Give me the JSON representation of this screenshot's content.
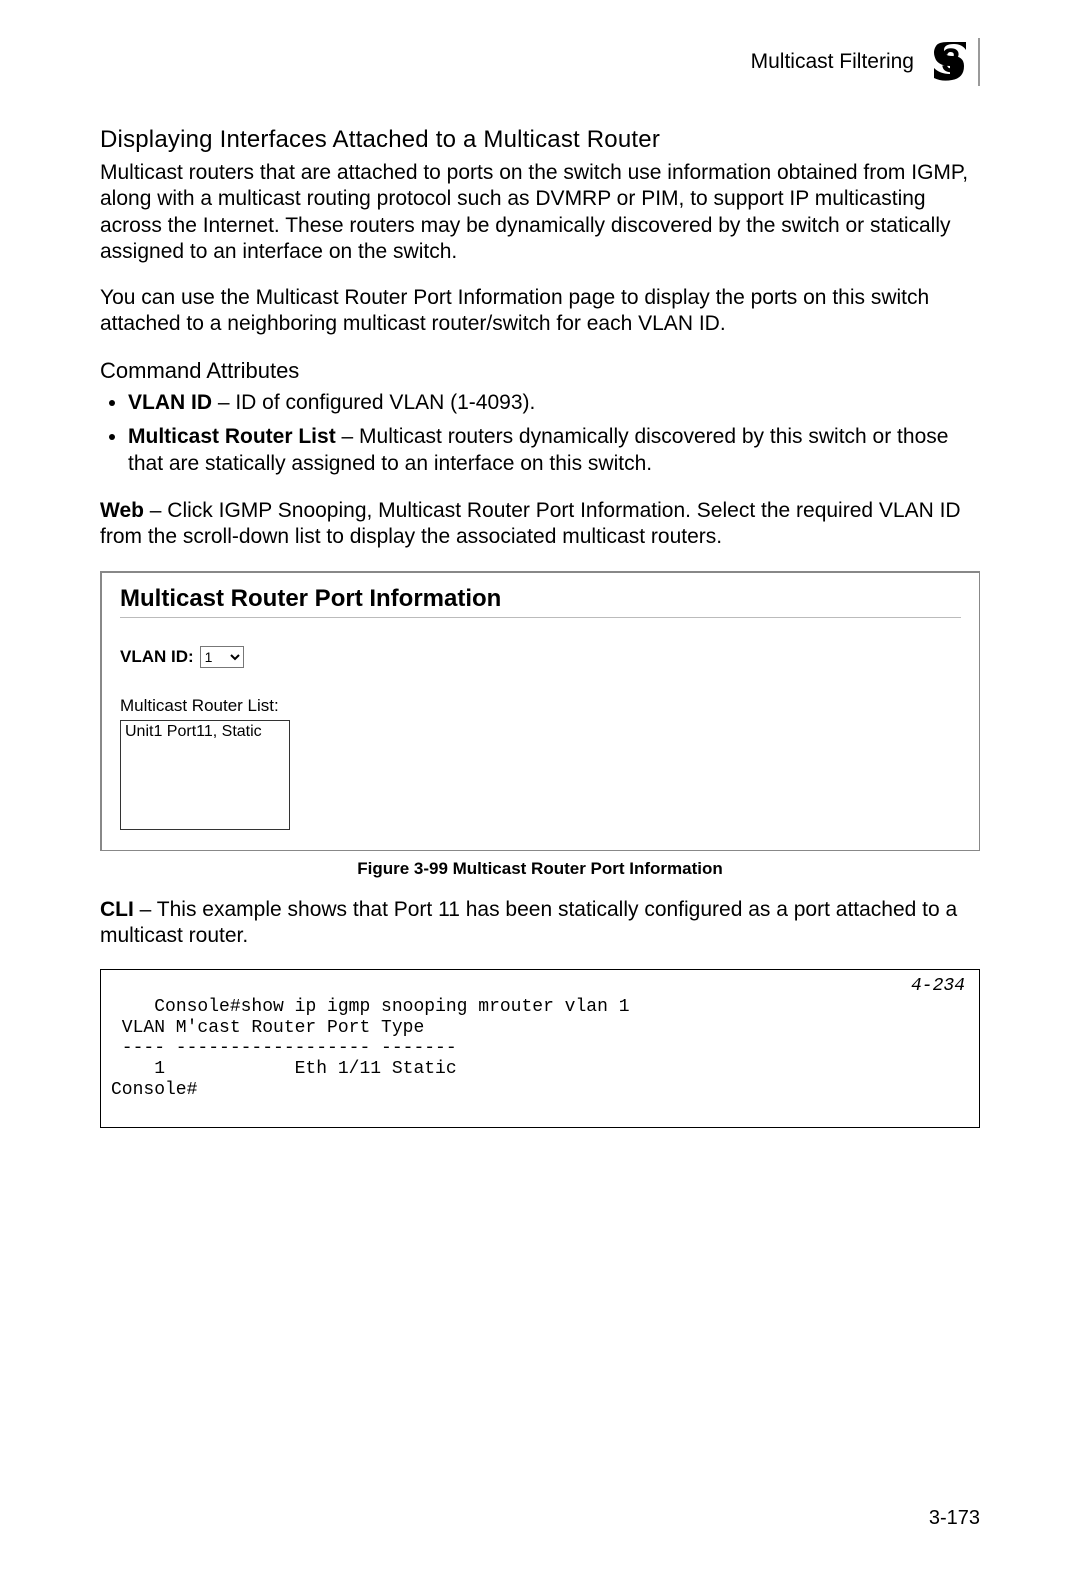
{
  "header": {
    "section": "Multicast Filtering",
    "chapter_number": "3"
  },
  "headings": {
    "h1": "Displaying Interfaces Attached to a Multicast Router",
    "command_attributes": "Command Attributes"
  },
  "paragraphs": {
    "p1": "Multicast routers that are attached to ports on the switch use information obtained from IGMP, along with a multicast routing protocol such as DVMRP or PIM, to support IP multicasting across the Internet. These routers may be dynamically discovered by the switch or statically assigned to an interface on the switch.",
    "p2": "You can use the Multicast Router Port Information page to display the ports on this switch attached to a neighboring multicast router/switch for each VLAN ID.",
    "web_instructions_prefix": "Web",
    "web_instructions": " – Click IGMP Snooping, Multicast Router Port Information. Select the required VLAN ID from the scroll-down list to display the associated multicast routers.",
    "cli_prefix": "CLI",
    "cli_text": " – This example shows that Port 11 has been statically configured as a port attached to a multicast router."
  },
  "attributes": {
    "item1_name": "VLAN ID",
    "item1_desc": " – ID of configured VLAN (1-4093).",
    "item2_name": "Multicast Router List",
    "item2_desc": " – Multicast routers dynamically discovered by this switch or those that are statically assigned to an interface on this switch."
  },
  "screenshot": {
    "panel_title": "Multicast Router Port Information",
    "vlan_label": "VLAN ID:",
    "vlan_selected": "1",
    "mrlist_label": "Multicast Router List:",
    "mrlist_entry": "Unit1 Port11, Static"
  },
  "figure_caption": "Figure 3-99   Multicast Router Port Information",
  "cli": {
    "ref": "4-234",
    "lines": "Console#show ip igmp snooping mrouter vlan 1\n VLAN M'cast Router Port Type\n ---- ------------------ -------\n    1            Eth 1/11 Static\nConsole#"
  },
  "page_number": "3-173"
}
